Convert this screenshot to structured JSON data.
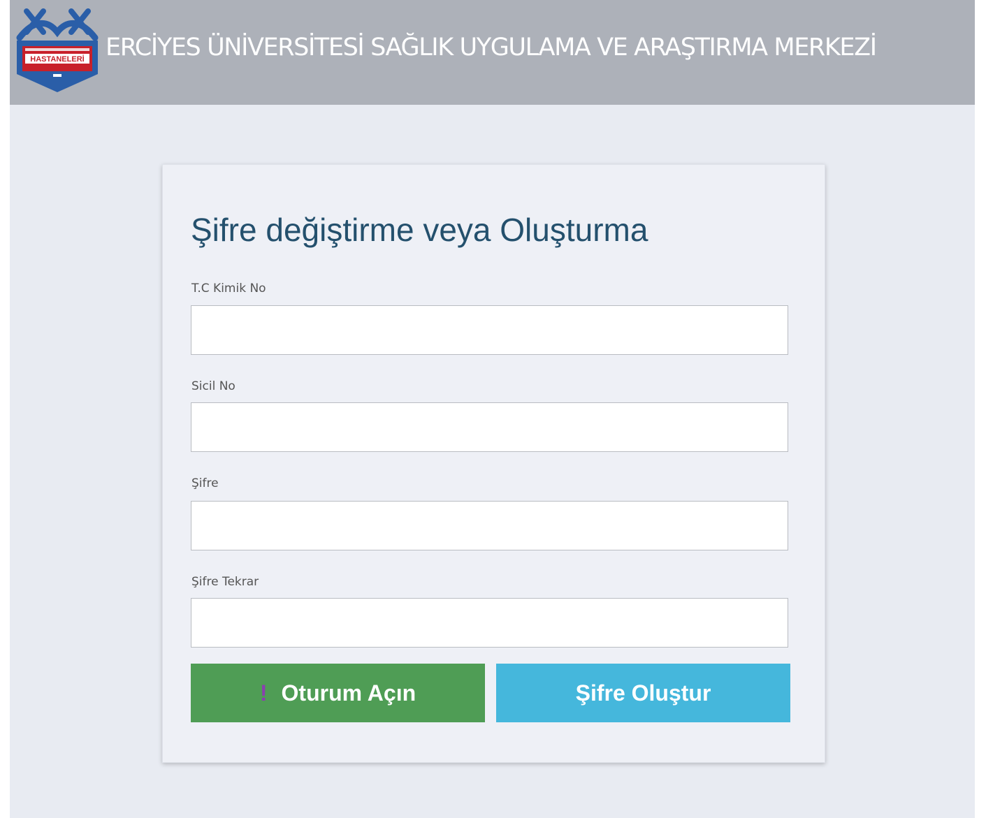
{
  "header": {
    "title": "ERCİYES ÜNİVERSİTESİ SAĞLIK UYGULAMA VE ARAŞTIRMA MERKEZİ",
    "logo_text": "HASTANELERİ",
    "logo_icon": "university-hospital-logo-icon"
  },
  "form": {
    "title": "Şifre değiştirme veya Oluşturma",
    "fields": [
      {
        "label": "T.C Kimik No",
        "value": "",
        "placeholder": ""
      },
      {
        "label": "Sicil No",
        "value": "",
        "placeholder": ""
      },
      {
        "label": "Şifre",
        "value": "",
        "placeholder": ""
      },
      {
        "label": "Şifre Tekrar",
        "value": "",
        "placeholder": ""
      }
    ],
    "buttons": {
      "login_label": "Oturum Açın",
      "login_icon": "exclamation-icon",
      "create_label": "Şifre Oluştur"
    }
  },
  "colors": {
    "header_bg": "#adb1b9",
    "page_bg": "#e8ebf2",
    "title_color": "#24506d",
    "login_button": "#4f9d55",
    "create_button": "#45b7dc",
    "logo_blue": "#2a5ea8",
    "logo_red": "#c8202a"
  }
}
